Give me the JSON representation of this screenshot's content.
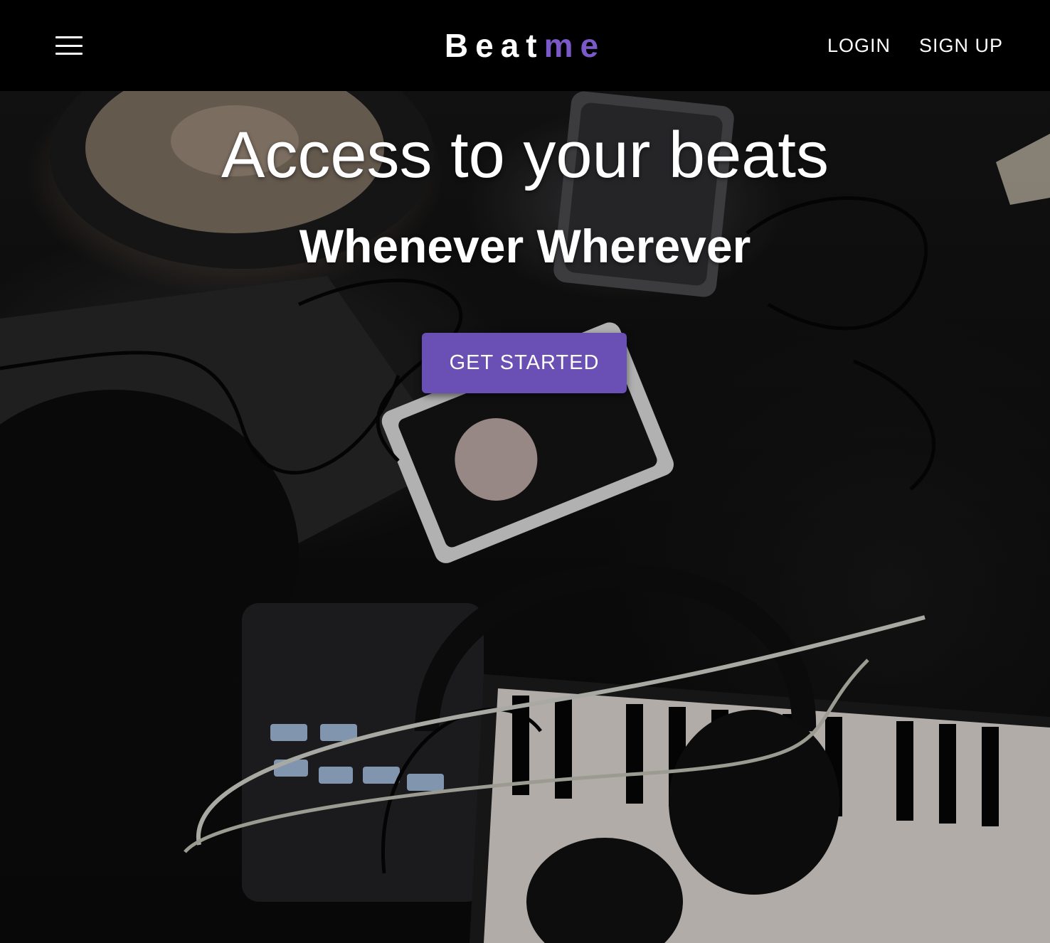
{
  "header": {
    "brand_main": "Beat",
    "brand_accent": "me",
    "login_label": "LOGIN",
    "signup_label": "SIGN UP",
    "menu_icon": "hamburger-menu-icon"
  },
  "hero": {
    "headline": "Access to your beats",
    "subheadline": "Whenever Wherever",
    "cta_label": "GET STARTED",
    "background_image": "music-studio-equipment-photo"
  },
  "colors": {
    "accent": "#7a5ac8",
    "button": "#6a4fb4",
    "bar": "#000000"
  }
}
